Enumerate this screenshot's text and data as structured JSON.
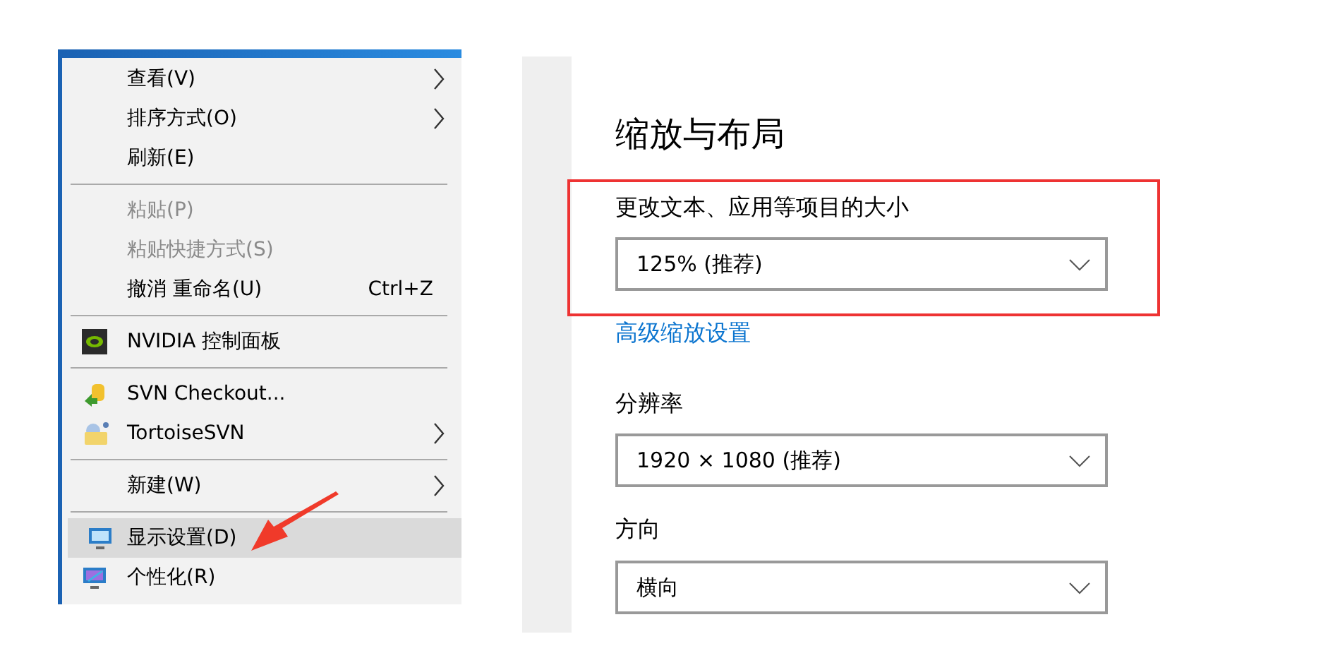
{
  "context_menu": {
    "items": [
      {
        "kind": "item",
        "label": "查看(V)",
        "disabled": false,
        "submenu": true,
        "selected": false
      },
      {
        "kind": "item",
        "label": "排序方式(O)",
        "disabled": false,
        "submenu": true,
        "selected": false
      },
      {
        "kind": "item",
        "label": "刷新(E)",
        "disabled": false,
        "submenu": false,
        "selected": false
      },
      {
        "kind": "separator"
      },
      {
        "kind": "item",
        "label": "粘贴(P)",
        "disabled": true,
        "submenu": false,
        "selected": false
      },
      {
        "kind": "item",
        "label": "粘贴快捷方式(S)",
        "disabled": true,
        "submenu": false,
        "selected": false
      },
      {
        "kind": "item",
        "label": "撤消 重命名(U)",
        "shortcut": "Ctrl+Z",
        "disabled": false,
        "submenu": false,
        "selected": false
      },
      {
        "kind": "separator"
      },
      {
        "kind": "item",
        "label": "NVIDIA 控制面板",
        "disabled": false,
        "submenu": false,
        "selected": false
      },
      {
        "kind": "separator"
      },
      {
        "kind": "item",
        "label": "SVN Checkout...",
        "disabled": false,
        "submenu": false,
        "selected": false
      },
      {
        "kind": "item",
        "label": "TortoiseSVN",
        "disabled": false,
        "submenu": true,
        "selected": false
      },
      {
        "kind": "separator"
      },
      {
        "kind": "item",
        "label": "新建(W)",
        "disabled": false,
        "submenu": true,
        "selected": false
      },
      {
        "kind": "separator"
      },
      {
        "kind": "item",
        "label": "显示设置(D)",
        "disabled": false,
        "submenu": false,
        "selected": true
      },
      {
        "kind": "item",
        "label": "个性化(R)",
        "disabled": false,
        "submenu": false,
        "selected": false
      }
    ]
  },
  "settings": {
    "title": "缩放与布局",
    "scale": {
      "label": "更改文本、应用等项目的大小",
      "value": "125% (推荐)"
    },
    "advanced_link": "高级缩放设置",
    "resolution": {
      "label": "分辨率",
      "value": "1920 × 1080 (推荐)"
    },
    "orientation": {
      "label": "方向",
      "value": "横向"
    }
  }
}
